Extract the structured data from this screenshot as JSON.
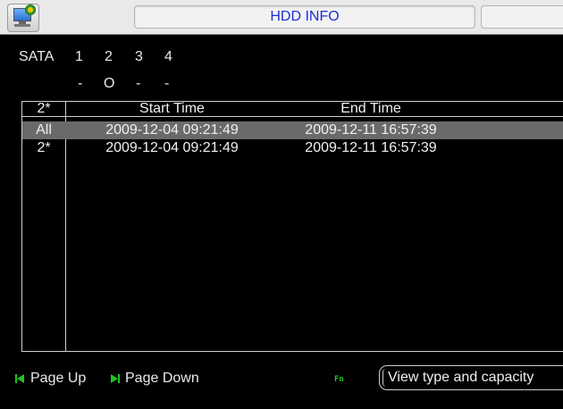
{
  "window": {
    "title": "HDD INFO"
  },
  "sata": {
    "label": "SATA",
    "disks": [
      {
        "number": "1",
        "status": "-"
      },
      {
        "number": "2",
        "status": "O"
      },
      {
        "number": "3",
        "status": "-"
      },
      {
        "number": "4",
        "status": "-"
      }
    ]
  },
  "table": {
    "headers": {
      "channel": "2*",
      "start": "Start Time",
      "end": "End Time"
    },
    "rows": [
      {
        "channel": "All",
        "start": "2009-12-04 09:21:49",
        "end": "2009-12-11 16:57:39",
        "selected": true
      },
      {
        "channel": "2*",
        "start": "2009-12-04 09:21:49",
        "end": "2009-12-11 16:57:39",
        "selected": false
      }
    ]
  },
  "footer": {
    "page_up": "Page Up",
    "page_down": "Page Down",
    "fn_icon": "Fn",
    "view_button": "View type and capacity"
  },
  "colors": {
    "background": "#000000",
    "title_text": "#1d2fd0",
    "highlight_row": "#6a6a6a",
    "nav_icon": "#23c223"
  }
}
